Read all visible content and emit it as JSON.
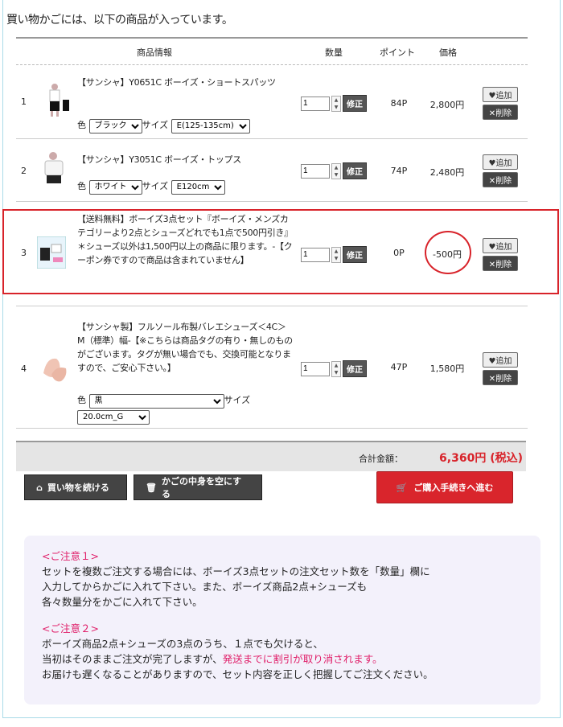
{
  "intro": "買い物かごには、以下の商品が入っています。",
  "headers": {
    "info": "商品情報",
    "qty": "数量",
    "point": "ポイント",
    "price": "価格"
  },
  "labels": {
    "color": "色",
    "size": "サイズ",
    "fix": "修正",
    "add": "追加",
    "del": "削除"
  },
  "items": [
    {
      "num": "1",
      "title": "【サンシャ】Y0651C ボーイズ・ショートスパッツ",
      "color": "ブラック",
      "size": "E(125-135cm)",
      "qty": "1",
      "points": "84P",
      "price": "2,800円"
    },
    {
      "num": "2",
      "title": "【サンシャ】Y3051C ボーイズ・トップス",
      "color": "ホワイト",
      "size": "E120cm",
      "qty": "1",
      "points": "74P",
      "price": "2,480円"
    },
    {
      "num": "3",
      "title": "【送料無料】ボーイズ3点セット『ボーイズ・メンズカテゴリーより2点とシューズどれでも1点で500円引き』 ＊シューズ以外は1,500円以上の商品に限ります。-【クーポン券ですので商品は含まれていません】",
      "qty": "1",
      "points": "0P",
      "price": "-500円"
    },
    {
      "num": "4",
      "title": "【サンシャ製】フルソール布製バレエシューズ＜4C＞ M（標準）幅-【※こちらは商品タグの有り・無しのものがございます。タグが無い場合でも、交換可能となりますので、ご安心下さい。】",
      "color": "黒",
      "size": "20.0cm_G",
      "qty": "1",
      "points": "47P",
      "price": "1,580円"
    }
  ],
  "total": {
    "label": "合計金額：",
    "value": "6,360円 (税込)"
  },
  "buttons": {
    "continue": "買い物を続ける",
    "empty": "かごの中身を空にする",
    "checkout": "ご購入手続きへ進む"
  },
  "notice": {
    "h1": "<ご注意１>",
    "p1": [
      "セットを複数ご注文する場合には、ボーイズ3点セットの注文セット数を「数量」欄に",
      "入力してからかごに入れて下さい。また、ボーイズ商品2点+シューズも",
      "各々数量分をかごに入れて下さい。"
    ],
    "h2": "<ご注意２>",
    "p2a": "ボーイズ商品2点+シューズの3点のうち、１点でも欠けると、",
    "p2b": "当初はそのままご注文が完了しますが、",
    "p2b_pink": "発送までに割引が取り消されます。",
    "p2c": "お届けも遅くなることがありますので、セット内容を正しく把握してご注文ください。"
  },
  "colors": {
    "accent": "#d8232a",
    "notice_bg": "#f3f1fb",
    "notice_head": "#e0206a"
  }
}
